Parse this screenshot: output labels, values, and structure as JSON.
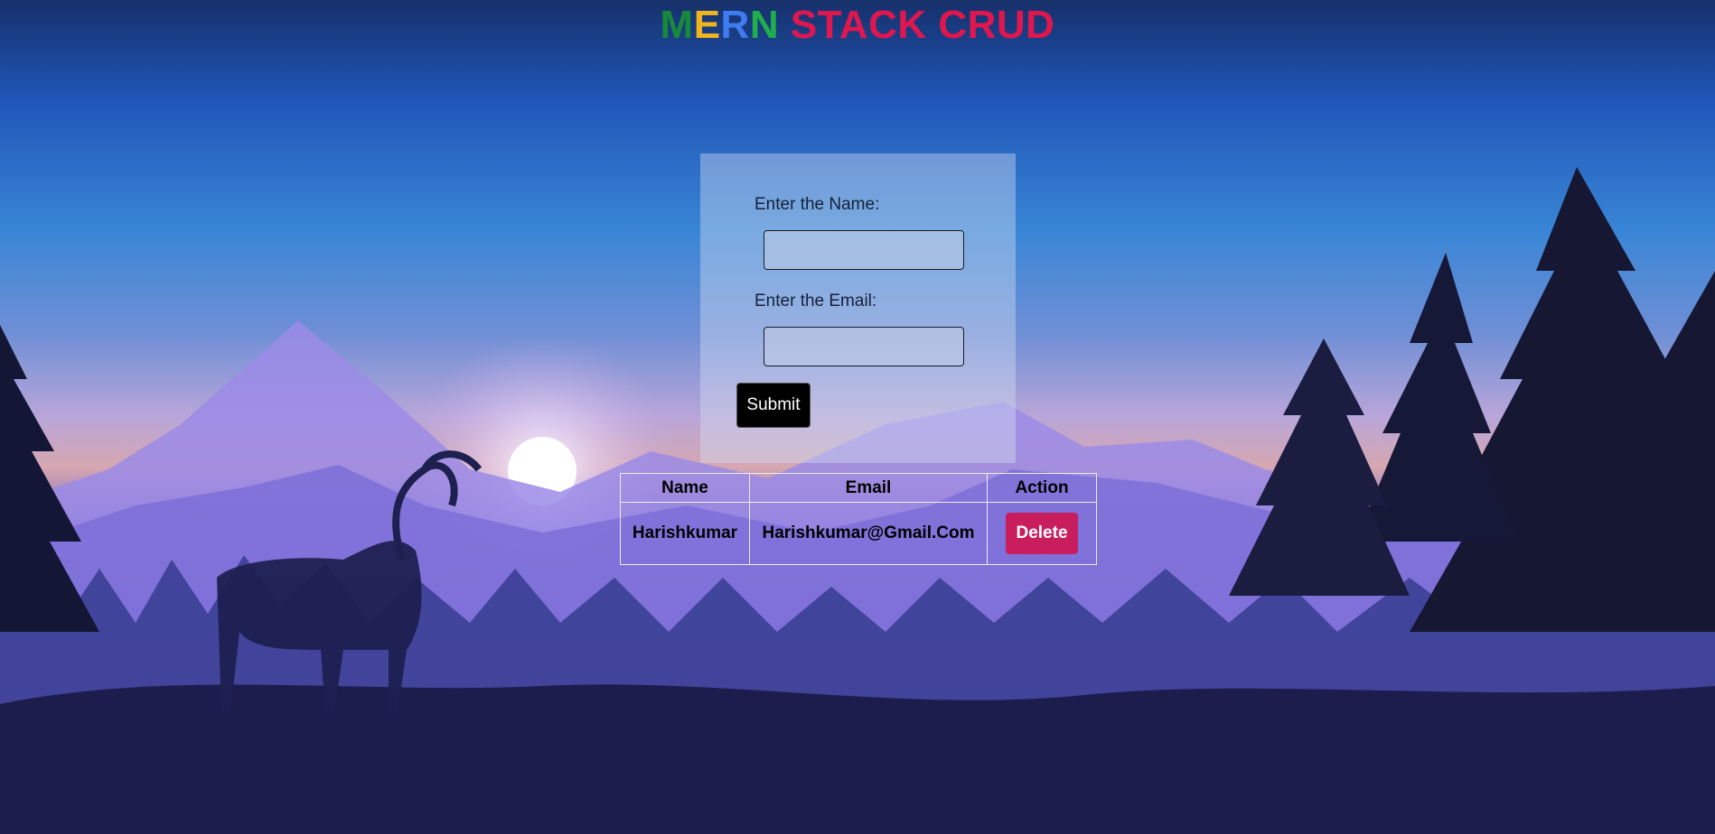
{
  "header": {
    "letters": [
      {
        "char": "M",
        "color": "#178a3a"
      },
      {
        "char": "E",
        "color": "#f0b41c"
      },
      {
        "char": "R",
        "color": "#3f7cf0"
      },
      {
        "char": "N",
        "color": "#1fae4b"
      }
    ],
    "rest": " STACK CRUD",
    "rest_color": "#e0174f"
  },
  "form": {
    "name_label": "Enter the Name:",
    "name_value": "",
    "email_label": "Enter the Email:",
    "email_value": "",
    "submit_label": "Submit"
  },
  "table": {
    "headers": [
      "Name",
      "Email",
      "Action"
    ],
    "rows": [
      {
        "name": "Harishkumar",
        "email": "Harishkumar@Gmail.Com",
        "action_label": "Delete"
      }
    ]
  },
  "colors": {
    "submit_bg": "#000000",
    "delete_bg": "#c81e5e"
  }
}
